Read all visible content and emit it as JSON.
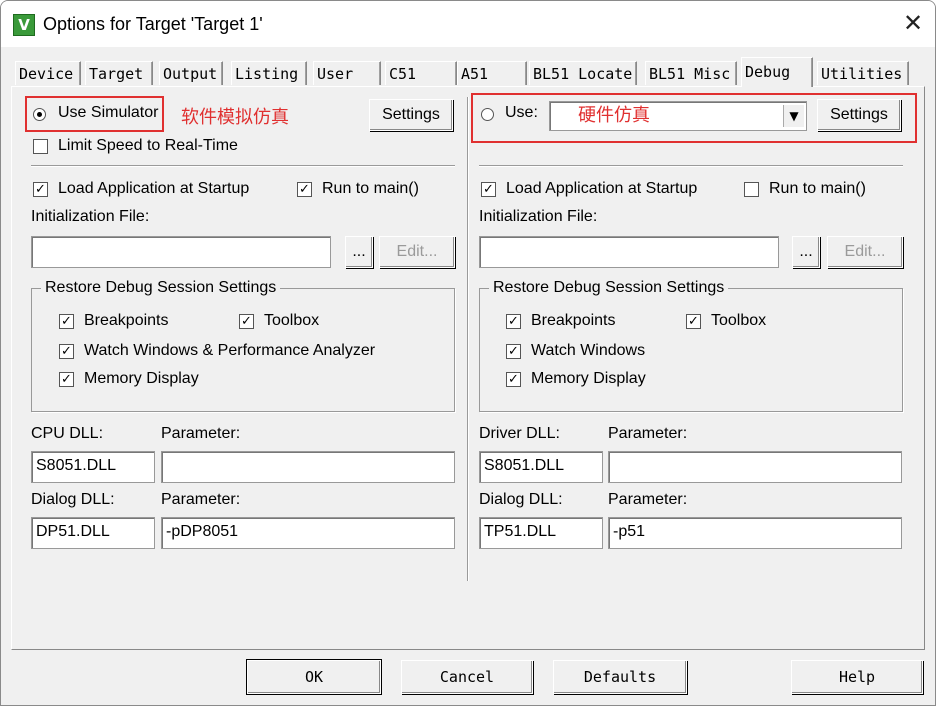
{
  "window": {
    "title": "Options for Target 'Target 1'",
    "app_icon_glyph": "V"
  },
  "tabs": [
    "Device",
    "Target",
    "Output",
    "Listing",
    "User",
    "C51",
    "A51",
    "BL51 Locate",
    "BL51 Misc",
    "Debug",
    "Utilities"
  ],
  "active_tab": "Debug",
  "left": {
    "use_simulator": "Use Simulator",
    "annotation": "软件模拟仿真",
    "settings": "Settings",
    "limit_speed": "Limit Speed to Real-Time",
    "load_app": "Load Application at Startup",
    "run_to_main": "Run to main()",
    "init_file_label": "Initialization File:",
    "browse": "...",
    "edit": "Edit...",
    "restore_group": "Restore Debug Session Settings",
    "breakpoints": "Breakpoints",
    "toolbox": "Toolbox",
    "watch": "Watch Windows & Performance Analyzer",
    "memory": "Memory Display",
    "cpu_dll_label": "CPU DLL:",
    "param_label_1": "Parameter:",
    "cpu_dll": "S8051.DLL",
    "cpu_param": "",
    "dialog_dll_label": "Dialog DLL:",
    "param_label_2": "Parameter:",
    "dialog_dll": "DP51.DLL",
    "dialog_param": "-pDP8051"
  },
  "right": {
    "use": "Use:",
    "annotation": "硬件仿真",
    "settings": "Settings",
    "load_app": "Load Application at Startup",
    "run_to_main": "Run to main()",
    "init_file_label": "Initialization File:",
    "browse": "...",
    "edit": "Edit...",
    "restore_group": "Restore Debug Session Settings",
    "breakpoints": "Breakpoints",
    "toolbox": "Toolbox",
    "watch": "Watch Windows",
    "memory": "Memory Display",
    "driver_dll_label": "Driver DLL:",
    "param_label_1": "Parameter:",
    "driver_dll": "S8051.DLL",
    "driver_param": "",
    "dialog_dll_label": "Dialog DLL:",
    "param_label_2": "Parameter:",
    "dialog_dll": "TP51.DLL",
    "dialog_param": "-p51"
  },
  "footer": {
    "ok": "OK",
    "cancel": "Cancel",
    "defaults": "Defaults",
    "help": "Help"
  },
  "colors": {
    "annotation": "#e03030",
    "face": "#f0f0f0"
  }
}
